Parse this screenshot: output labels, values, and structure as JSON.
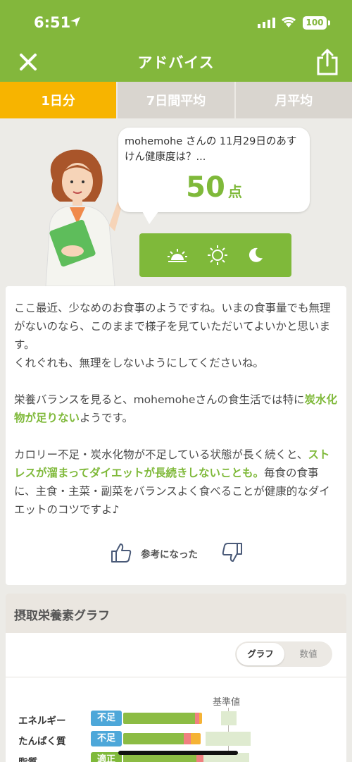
{
  "status_bar": {
    "time": "6:51",
    "battery": "100"
  },
  "header": {
    "title": "アドバイス",
    "close_icon": "close-icon",
    "share_icon": "share-icon"
  },
  "tabs": [
    {
      "label": "1日分",
      "active": true
    },
    {
      "label": "7日間平均",
      "active": false
    },
    {
      "label": "月平均",
      "active": false
    }
  ],
  "score_bubble": {
    "question": "mohemohe さんの 11月29日のあすけん健康度は？...",
    "score": "50",
    "unit": "点"
  },
  "meal_times": [
    {
      "icon": "sunrise-icon",
      "name": "morning"
    },
    {
      "icon": "sun-icon",
      "name": "noon"
    },
    {
      "icon": "moon-icon",
      "name": "night"
    }
  ],
  "advice": {
    "p1": "ここ最近、少なめのお食事のようですね。いまの食事量でも無理がないのなら、このままで様子を見ていただいてよいかと思います。",
    "p1b": "くれぐれも、無理をしないようにしてくださいね。",
    "p2_pre": "栄養バランスを見ると、mohemoheさんの食生活では特に",
    "p2_hl": "炭水化物が足りない",
    "p2_post": "ようです。",
    "p3_pre": "カロリー不足・炭水化物が不足している状態が長く続くと、",
    "p3_hl": "ストレスが溜まってダイエットが長続きしないことも。",
    "p3_post": "毎食の食事に、主食・主菜・副菜をバランスよく食べることが健康的なダイエットのコツですよ♪",
    "helpful_label": "参考になった"
  },
  "nutrients": {
    "title": "摂取栄養素グラフ",
    "toggle": {
      "graph": "グラフ",
      "values": "数値"
    },
    "standard_label": "基準値",
    "rows": [
      {
        "name": "エネルギー",
        "status": "不足",
        "status_color": "#4da7d9"
      },
      {
        "name": "たんぱく質",
        "status": "不足",
        "status_color": "#4da7d9"
      },
      {
        "name": "脂質",
        "status": "適正",
        "status_color": "#7fb93a"
      }
    ]
  },
  "colors": {
    "brand": "#83b73c",
    "tab_active": "#f7b400",
    "highlight": "#7fb93a",
    "deficient": "#4da7d9"
  }
}
